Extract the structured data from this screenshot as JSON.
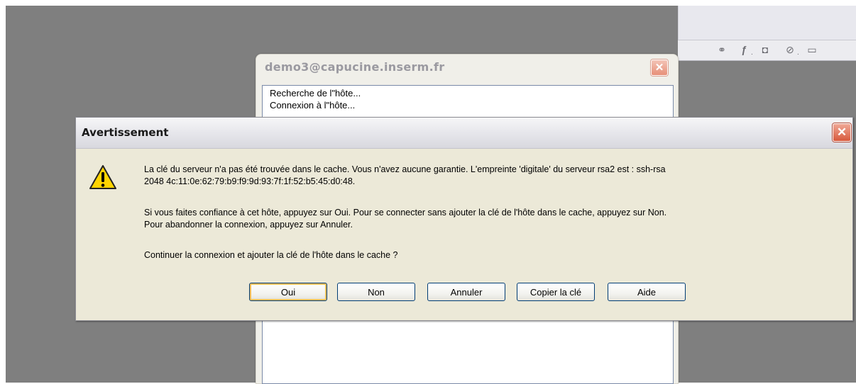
{
  "putty_window": {
    "title": "demo3@capucine.inserm.fr",
    "close_glyph": "✕",
    "log_lines": [
      "Recherche de l\"hôte...",
      "Connexion à l\"hôte..."
    ]
  },
  "side_toolbar": {
    "icons": [
      "link-icon",
      "fx-icon",
      "mask-icon",
      "brush-icon",
      "folder-icon"
    ]
  },
  "dialog": {
    "title": "Avertissement",
    "close_glyph": "✕",
    "icon": "warning-icon",
    "message_line1": "La clé du serveur n'a pas été trouvée dans le cache. Vous n'avez aucune garantie. L'empreinte 'digitale' du serveur rsa2 est : ssh-rsa",
    "message_line2": "2048 4c:11:0e:62:79:b9:f9:9d:93:7f:1f:52:b5:45:d0:48.",
    "message_line3": "Si vous faites confiance à cet hôte, appuyez sur Oui. Pour se connecter sans ajouter la clé de l'hôte dans le cache, appuyez sur Non.",
    "message_line4": "Pour abandonner la connexion, appuyez sur Annuler.",
    "message_line5": "Continuer la connexion et ajouter la clé de l'hôte dans le cache ?",
    "buttons": {
      "yes": "Oui",
      "no": "Non",
      "cancel": "Annuler",
      "copy_key": "Copier la clé",
      "help": "Aide"
    }
  },
  "colors": {
    "desktop": "#7f7f7f",
    "dialog_bg": "#ece9d8",
    "button_border": "#003c74",
    "default_button_highlight": "#f6c05a"
  }
}
